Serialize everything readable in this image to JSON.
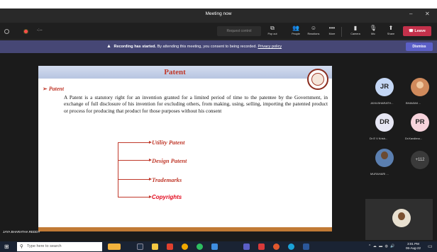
{
  "window": {
    "title": "Meeting now",
    "minimize": "–",
    "close": "✕"
  },
  "toolbar": {
    "timer": "-:--",
    "request_control": "Request control",
    "buttons": [
      {
        "label": "Pop out",
        "icon": "pop-out-icon",
        "glyph": "⧉"
      },
      {
        "label": "People",
        "icon": "people-icon",
        "glyph": "👥"
      },
      {
        "label": "Reactions",
        "icon": "reactions-icon",
        "glyph": "☺"
      },
      {
        "label": "More",
        "icon": "more-icon",
        "glyph": "•••"
      },
      {
        "label": "Camera",
        "icon": "camera-icon",
        "glyph": "▮"
      },
      {
        "label": "Mic",
        "icon": "mic-icon",
        "glyph": "🎙"
      },
      {
        "label": "Share",
        "icon": "share-icon",
        "glyph": "⬆"
      }
    ],
    "leave": "Leave",
    "leave_color": "#c4314b"
  },
  "banner": {
    "bold": "Recording has started.",
    "text": "By attending this meeting, you consent to being recorded.",
    "link": "Privacy policy",
    "dismiss": "Dismiss"
  },
  "slide": {
    "title": "Patent",
    "bullet": "Patent",
    "bullet_arrow": "➢",
    "paragraph": "A Patent is a statutory right for an invention granted for a limited period of time to the patentee by the Government, in exchange of full disclosure of his invention for excluding others, from making, using, selling, importing the patented product or process for producing that product for those purposes without his consent",
    "types": [
      "Utility Patent",
      "Design Patent",
      "Trademarks",
      "Copyrights"
    ]
  },
  "presenter_name": "JAYA BHARATHA REDDY",
  "participants": [
    {
      "initials": "JR",
      "name": "JAYA BHARATH...",
      "color": "#c4d7f5"
    },
    {
      "initials": "",
      "name": "BHAVANI ...",
      "color": "#d08a5c"
    },
    {
      "initials": "DR",
      "name": "Dr E V Krish...",
      "color": "#e6e6f3"
    },
    {
      "initials": "PR",
      "name": "Dr.Kavdima...",
      "color": "#f7d3dc"
    },
    {
      "initials": "",
      "name": "MURAHARI ...",
      "color": "#5b7fb0"
    }
  ],
  "more_count": "+112",
  "taskbar": {
    "search_placeholder": "Type here to search",
    "time": "3:01 PM",
    "date": "06-Aug-22"
  }
}
